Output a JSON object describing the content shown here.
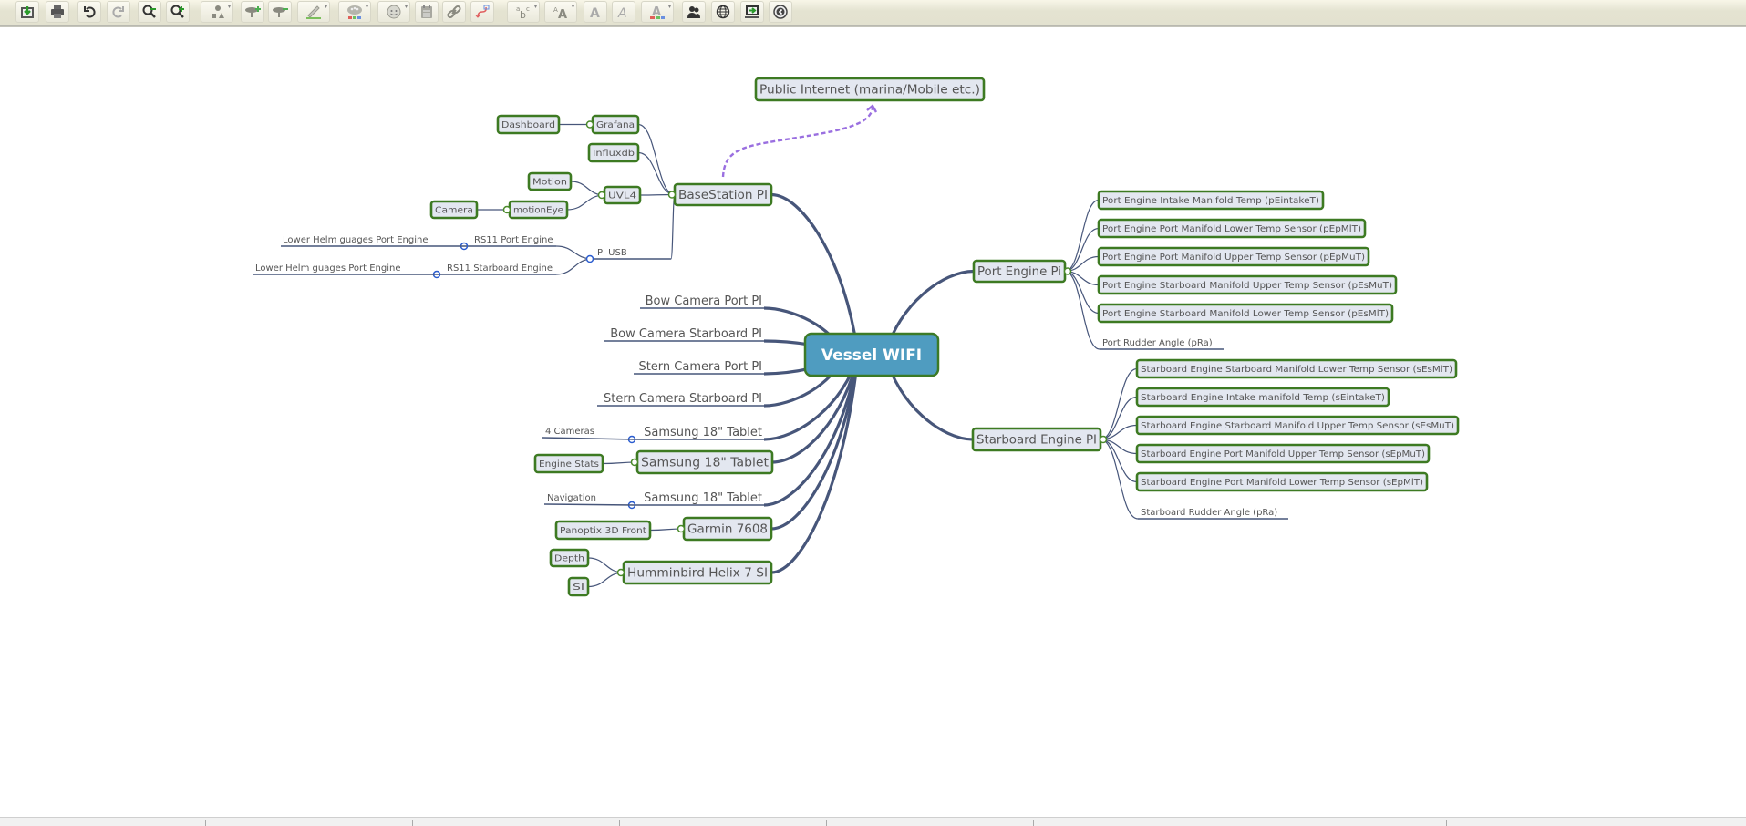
{
  "toolbar": {
    "buttons": [
      {
        "name": "export-button",
        "icon": "export-icon"
      },
      {
        "name": "print-button",
        "icon": "print-icon"
      },
      {
        "name": "undo-button",
        "icon": "undo-icon"
      },
      {
        "name": "redo-button",
        "icon": "redo-icon"
      },
      {
        "name": "zoom-out-button",
        "icon": "zoom-out-icon"
      },
      {
        "name": "zoom-in-button",
        "icon": "zoom-in-icon"
      },
      {
        "name": "topic-shape-button",
        "icon": "shapes-icon"
      },
      {
        "name": "add-topic-button",
        "icon": "add-topic-icon"
      },
      {
        "name": "delete-topic-button",
        "icon": "delete-topic-icon"
      },
      {
        "name": "border-color-button",
        "icon": "pencil-icon"
      },
      {
        "name": "background-color-button",
        "icon": "palette-icon"
      },
      {
        "name": "icon-picker-button",
        "icon": "smiley-icon"
      },
      {
        "name": "note-button",
        "icon": "note-icon"
      },
      {
        "name": "link-button",
        "icon": "link-icon"
      },
      {
        "name": "relationship-button",
        "icon": "relationship-icon"
      },
      {
        "name": "font-family-button",
        "icon": "font-family-icon"
      },
      {
        "name": "font-size-button",
        "icon": "font-size-icon"
      },
      {
        "name": "bold-button",
        "icon": "bold-icon"
      },
      {
        "name": "italic-button",
        "icon": "italic-icon"
      },
      {
        "name": "font-color-button",
        "icon": "font-color-icon"
      },
      {
        "name": "share-button",
        "icon": "users-icon"
      },
      {
        "name": "publish-button",
        "icon": "globe-icon"
      },
      {
        "name": "history-button",
        "icon": "history-icon"
      },
      {
        "name": "back-button",
        "icon": "back-icon"
      }
    ]
  },
  "mindmap": {
    "colors": {
      "central_fill": "#4f9cc0",
      "central_border": "#3c7a26",
      "central_text": "#ffffff",
      "node_fill": "#e3e7f0",
      "node_border": "#3d7a22",
      "node_text": "#555555",
      "connector": "#47567a",
      "relationship": "#9a6fe0",
      "handle_blue": "#2a5ccf",
      "handle_green": "#4a8a2a"
    },
    "central": {
      "id": "central",
      "label": "Vessel WIFI"
    },
    "nodes": [
      {
        "id": "basestation",
        "label": "BaseStation PI",
        "boxed": true
      },
      {
        "id": "public-internet",
        "label": "Public Internet (marina/Mobile etc.)",
        "boxed": true
      },
      {
        "id": "grafana",
        "label": "Grafana",
        "boxed": true
      },
      {
        "id": "dashboard",
        "label": "Dashboard",
        "boxed": true
      },
      {
        "id": "influxdb",
        "label": "Influxdb",
        "boxed": true
      },
      {
        "id": "uvl4",
        "label": "UVL4",
        "boxed": true
      },
      {
        "id": "motion",
        "label": "Motion",
        "boxed": true
      },
      {
        "id": "motioneye",
        "label": "motionEye",
        "boxed": true
      },
      {
        "id": "camera",
        "label": "Camera",
        "boxed": true
      },
      {
        "id": "pi-usb",
        "label": "PI USB",
        "boxed": false
      },
      {
        "id": "rs11-port",
        "label": "RS11 Port Engine",
        "boxed": false
      },
      {
        "id": "rs11-stbd",
        "label": "RS11 Starboard Engine",
        "boxed": false
      },
      {
        "id": "lower-helm-1",
        "label": "Lower Helm guages Port Engine",
        "boxed": false
      },
      {
        "id": "lower-helm-2",
        "label": "Lower Helm guages Port Engine",
        "boxed": false
      },
      {
        "id": "bow-cam-port",
        "label": "Bow Camera Port PI",
        "boxed": false
      },
      {
        "id": "bow-cam-stbd",
        "label": "Bow Camera Starboard PI",
        "boxed": false
      },
      {
        "id": "stern-cam-port",
        "label": "Stern Camera Port PI",
        "boxed": false
      },
      {
        "id": "stern-cam-stbd",
        "label": "Stern Camera Starboard PI",
        "boxed": false
      },
      {
        "id": "tablet-1",
        "label": "Samsung 18\" Tablet",
        "boxed": false
      },
      {
        "id": "four-cameras",
        "label": "4 Cameras",
        "boxed": false
      },
      {
        "id": "tablet-2",
        "label": "Samsung 18\" Tablet",
        "boxed": true
      },
      {
        "id": "engine-stats",
        "label": "Engine Stats",
        "boxed": true
      },
      {
        "id": "tablet-3",
        "label": "Samsung 18\" Tablet",
        "boxed": false
      },
      {
        "id": "navigation",
        "label": "Navigation",
        "boxed": false
      },
      {
        "id": "garmin",
        "label": "Garmin 7608",
        "boxed": true
      },
      {
        "id": "panoptix",
        "label": "Panoptix 3D Front",
        "boxed": true
      },
      {
        "id": "humminbird",
        "label": "Humminbird Helix 7 SI",
        "boxed": true
      },
      {
        "id": "depth",
        "label": "Depth",
        "boxed": true
      },
      {
        "id": "si",
        "label": "SI",
        "boxed": true
      },
      {
        "id": "port-engine",
        "label": "Port Engine Pi",
        "boxed": true
      },
      {
        "id": "pe-intake",
        "label": "Port Engine Intake Manifold Temp (pEintakeT)",
        "boxed": true
      },
      {
        "id": "pe-pml",
        "label": "Port Engine Port Manifold Lower Temp Sensor (pEpMlT)",
        "boxed": true
      },
      {
        "id": "pe-pmu",
        "label": "Port Engine Port Manifold Upper Temp Sensor (pEpMuT)",
        "boxed": true
      },
      {
        "id": "pe-smu",
        "label": "Port Engine Starboard Manifold Upper Temp Sensor (pEsMuT)",
        "boxed": true
      },
      {
        "id": "pe-sml",
        "label": "Port Engine Starboard Manifold Lower Temp Sensor (pEsMlT)",
        "boxed": true
      },
      {
        "id": "pe-rudder",
        "label": "Port Rudder Angle (pRa)",
        "boxed": false
      },
      {
        "id": "stbd-engine",
        "label": "Starboard Engine PI",
        "boxed": true
      },
      {
        "id": "se-sml",
        "label": "Starboard Engine Starboard Manifold Lower Temp Sensor (sEsMlT)",
        "boxed": true
      },
      {
        "id": "se-intake",
        "label": "Starboard Engine Intake manifold Temp (sEintakeT)",
        "boxed": true
      },
      {
        "id": "se-smu",
        "label": "Starboard Engine Starboard Manifold Upper Temp Sensor (sEsMuT)",
        "boxed": true
      },
      {
        "id": "se-pmu",
        "label": "Starboard Engine Port Manifold Upper Temp Sensor (sEpMuT)",
        "boxed": true
      },
      {
        "id": "se-pml",
        "label": "Starboard Engine Port Manifold Lower Temp Sensor (sEpMlT)",
        "boxed": true
      },
      {
        "id": "se-rudder",
        "label": "Starboard Rudder Angle (pRa)",
        "boxed": false
      }
    ],
    "edges": [
      {
        "from": "central",
        "to": "basestation"
      },
      {
        "from": "basestation",
        "to": "grafana"
      },
      {
        "from": "grafana",
        "to": "dashboard"
      },
      {
        "from": "basestation",
        "to": "influxdb"
      },
      {
        "from": "basestation",
        "to": "uvl4"
      },
      {
        "from": "uvl4",
        "to": "motion"
      },
      {
        "from": "uvl4",
        "to": "motioneye"
      },
      {
        "from": "motioneye",
        "to": "camera"
      },
      {
        "from": "basestation",
        "to": "pi-usb"
      },
      {
        "from": "pi-usb",
        "to": "rs11-port"
      },
      {
        "from": "pi-usb",
        "to": "rs11-stbd"
      },
      {
        "from": "rs11-port",
        "to": "lower-helm-1"
      },
      {
        "from": "rs11-stbd",
        "to": "lower-helm-2"
      },
      {
        "from": "central",
        "to": "bow-cam-port"
      },
      {
        "from": "central",
        "to": "bow-cam-stbd"
      },
      {
        "from": "central",
        "to": "stern-cam-port"
      },
      {
        "from": "central",
        "to": "stern-cam-stbd"
      },
      {
        "from": "central",
        "to": "tablet-1"
      },
      {
        "from": "tablet-1",
        "to": "four-cameras"
      },
      {
        "from": "central",
        "to": "tablet-2"
      },
      {
        "from": "tablet-2",
        "to": "engine-stats"
      },
      {
        "from": "central",
        "to": "tablet-3"
      },
      {
        "from": "tablet-3",
        "to": "navigation"
      },
      {
        "from": "central",
        "to": "garmin"
      },
      {
        "from": "garmin",
        "to": "panoptix"
      },
      {
        "from": "central",
        "to": "humminbird"
      },
      {
        "from": "humminbird",
        "to": "depth"
      },
      {
        "from": "humminbird",
        "to": "si"
      },
      {
        "from": "central",
        "to": "port-engine"
      },
      {
        "from": "port-engine",
        "to": "pe-intake"
      },
      {
        "from": "port-engine",
        "to": "pe-pml"
      },
      {
        "from": "port-engine",
        "to": "pe-pmu"
      },
      {
        "from": "port-engine",
        "to": "pe-smu"
      },
      {
        "from": "port-engine",
        "to": "pe-sml"
      },
      {
        "from": "port-engine",
        "to": "pe-rudder"
      },
      {
        "from": "central",
        "to": "stbd-engine"
      },
      {
        "from": "stbd-engine",
        "to": "se-sml"
      },
      {
        "from": "stbd-engine",
        "to": "se-intake"
      },
      {
        "from": "stbd-engine",
        "to": "se-smu"
      },
      {
        "from": "stbd-engine",
        "to": "se-pmu"
      },
      {
        "from": "stbd-engine",
        "to": "se-pml"
      },
      {
        "from": "stbd-engine",
        "to": "se-rudder"
      }
    ],
    "relationships": [
      {
        "from": "basestation",
        "to": "public-internet",
        "style": "dashed"
      }
    ]
  }
}
